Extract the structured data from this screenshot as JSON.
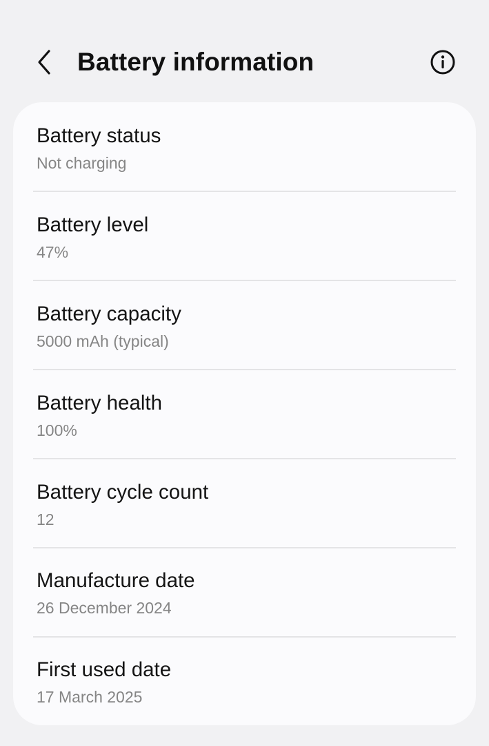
{
  "header": {
    "title": "Battery information",
    "back_icon": "chevron-left-icon",
    "info_icon": "info-circle-icon"
  },
  "items": [
    {
      "title": "Battery status",
      "value": "Not charging"
    },
    {
      "title": "Battery level",
      "value": "47%"
    },
    {
      "title": "Battery capacity",
      "value": "5000 mAh (typical)"
    },
    {
      "title": "Battery health",
      "value": "100%"
    },
    {
      "title": "Battery cycle count",
      "value": "12"
    },
    {
      "title": "Manufacture date",
      "value": "26 December 2024"
    },
    {
      "title": "First used date",
      "value": "17 March 2025"
    }
  ],
  "colors": {
    "background": "#f1f1f3",
    "card": "#fbfbfd",
    "title_text": "#111111",
    "secondary_text": "#858585",
    "divider": "#e4e4e6"
  }
}
